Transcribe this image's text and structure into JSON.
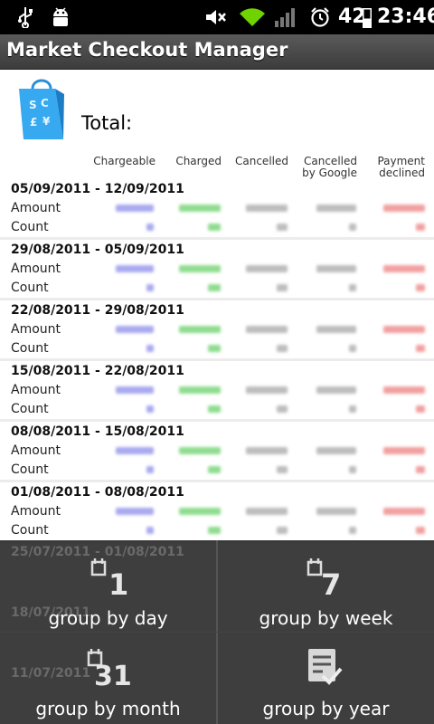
{
  "status_bar": {
    "battery_level": "42",
    "time": "23:46",
    "icons": [
      "usb-icon",
      "android-debug-icon",
      "mute-icon",
      "wifi-icon",
      "signal-icon",
      "alarm-icon",
      "battery-icon"
    ]
  },
  "app": {
    "title": "Market Checkout Manager"
  },
  "summary": {
    "total_label": "Total:"
  },
  "columns": {
    "chargeable": "Chargeable",
    "charged": "Charged",
    "cancelled": "Cancelled",
    "cancelled_by_google": "Cancelled by Google",
    "payment_declined": "Payment declined"
  },
  "row_labels": {
    "amount": "Amount",
    "count": "Count"
  },
  "periods": [
    {
      "date": "05/09/2011 - 12/09/2011"
    },
    {
      "date": "29/08/2011 - 05/09/2011"
    },
    {
      "date": "22/08/2011 - 29/08/2011"
    },
    {
      "date": "15/08/2011 - 22/08/2011"
    },
    {
      "date": "08/08/2011 - 15/08/2011"
    },
    {
      "date": "01/08/2011 - 08/08/2011"
    }
  ],
  "obscured_periods": [
    {
      "date": "25/07/2011 - 01/08/2011"
    },
    {
      "date": "18/07/2011"
    },
    {
      "date": "11/07/2011"
    }
  ],
  "colors": {
    "chargeable": "#a9a9f0",
    "charged": "#8fdc8f",
    "cancelled": "#bdbdbd",
    "cancelled_by_google": "#bdbdbd",
    "payment_declined": "#f2a0a0"
  },
  "menu": {
    "day": {
      "label": "group by day",
      "icon_number": "1"
    },
    "week": {
      "label": "group by week",
      "icon_number": "7"
    },
    "month": {
      "label": "group by month",
      "icon_number": "31"
    },
    "year": {
      "label": "group by year"
    }
  }
}
